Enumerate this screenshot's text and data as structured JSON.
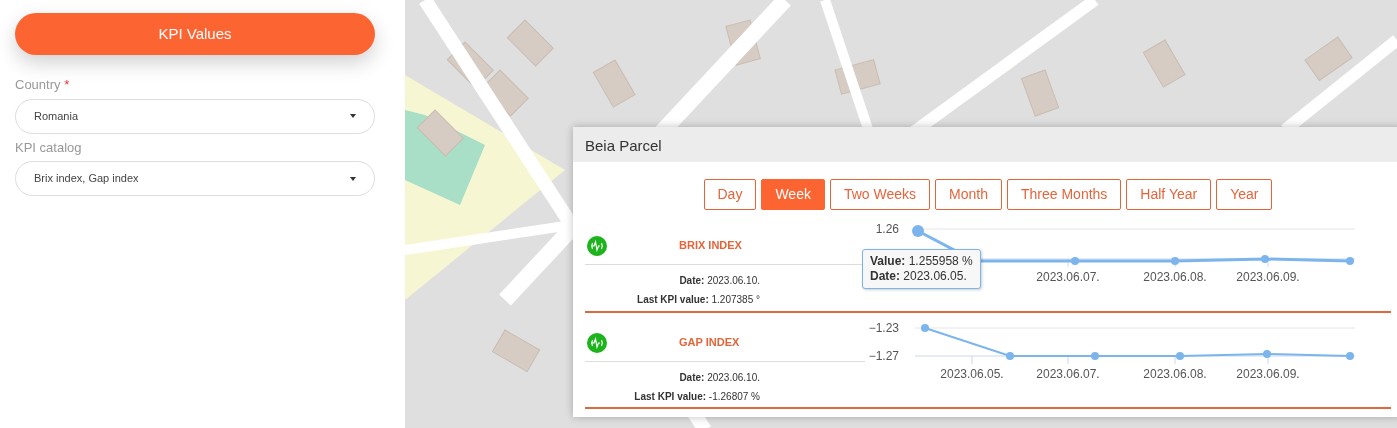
{
  "sidebar": {
    "title_button": "KPI Values",
    "fields": [
      {
        "label": "Country",
        "required": true,
        "required_mark": "*",
        "value": "Romania"
      },
      {
        "label": "KPI catalog",
        "required": false,
        "value": "Brix index, Gap index"
      }
    ]
  },
  "popup": {
    "title": "Beia Parcel",
    "periods": [
      {
        "label": "Day",
        "selected": false
      },
      {
        "label": "Week",
        "selected": true
      },
      {
        "label": "Two Weeks",
        "selected": false
      },
      {
        "label": "Month",
        "selected": false
      },
      {
        "label": "Three Months",
        "selected": false
      },
      {
        "label": "Half Year",
        "selected": false
      },
      {
        "label": "Year",
        "selected": false
      }
    ],
    "kpis": [
      {
        "name": "BRIX INDEX",
        "date": "**Date:** 2023.06.10.",
        "last_value": "**Last KPI value:** 1.207385 °",
        "tooltip": [
          {
            "label": "Value:",
            "value": "1.255958 %"
          },
          {
            "label": "Date:",
            "value": "2023.06.05."
          }
        ],
        "y_labels": [
          "1.26"
        ],
        "x_labels": [
          "2023.06.07.",
          "2023.06.08.",
          "2023.06.09."
        ]
      },
      {
        "name": "GAP INDEX",
        "date": "**Date:** 2023.06.10.",
        "last_value": "**Last KPI value:** -1.26807 %",
        "y_labels": [
          "−1.23",
          "−1.27"
        ],
        "x_labels": [
          "2023.06.05.",
          "2023.06.07.",
          "2023.06.08.",
          "2023.06.09."
        ]
      }
    ]
  }
}
